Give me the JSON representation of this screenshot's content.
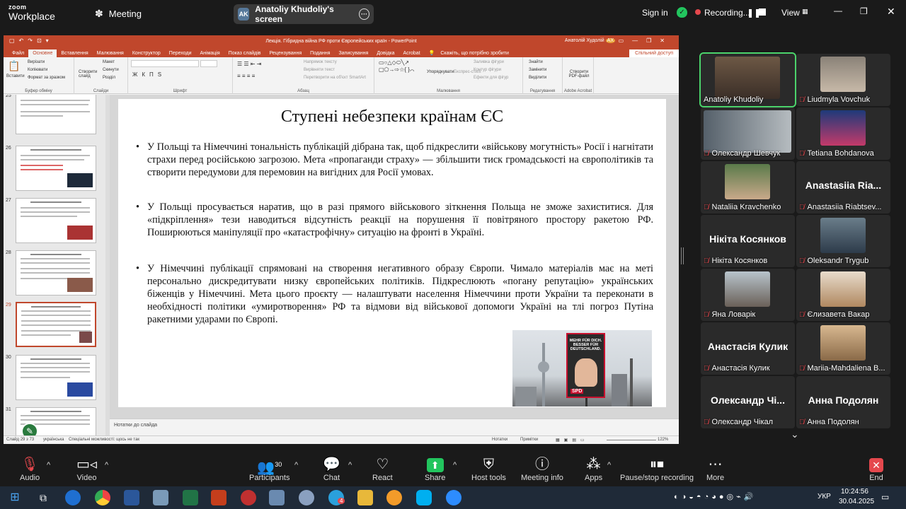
{
  "zoom": {
    "logo_line1": "zoom",
    "logo_line2": "Workplace",
    "meeting_label": "Meeting",
    "screen_share": {
      "initials": "AK",
      "label": "Anatoliy Khudoliy's screen"
    },
    "sign_in": "Sign in",
    "recording": "Recording...",
    "view": "View"
  },
  "ppt": {
    "window_title": "Лекція. Гібридна війна РФ проти Європейських країн - PowerPoint",
    "user": "Анатолій Худолій",
    "user_initials": "АХ",
    "tabs": [
      "Файл",
      "Основне",
      "Вставлення",
      "Малювання",
      "Конструктор",
      "Переходи",
      "Анімація",
      "Показ слайдів",
      "Рецензування",
      "Подання",
      "Записування",
      "Довідка",
      "Acrobat"
    ],
    "tell_me": "Скажіть, що потрібно зробити",
    "share": "Спільний доступ",
    "ribbon": {
      "clipboard": {
        "paste": "Вставити",
        "cut": "Вирізати",
        "copy": "Копіювати",
        "format": "Формат за зразком",
        "label": "Буфер обміну"
      },
      "slides": {
        "new": "Створити слайд",
        "layout": "Макет",
        "reset": "Скинути",
        "section": "Розділ",
        "label": "Слайди"
      },
      "font_label": "Шрифт",
      "paragraph": {
        "direction": "Напрямок тексту",
        "align": "Вирівняти текст",
        "smartart": "Перетворити на об'єкт SmartArt",
        "label": "Абзац"
      },
      "drawing": {
        "arrange": "Упорядкувати",
        "quick": "Експрес-стилі",
        "fill": "Заливка фігури",
        "outline": "Контур фігури",
        "effects": "Ефекти для фігур",
        "label": "Малювання"
      },
      "editing": {
        "find": "Знайти",
        "replace": "Замінити",
        "select": "Виділити",
        "label": "Редагування"
      },
      "acrobat": {
        "create": "Створити PDF-файл",
        "label": "Adobe Acrobat"
      }
    },
    "thumbnails": [
      {
        "num": "25",
        "title": "В Україні і наприклад країни та Європі та Ф.Р. з роки"
      },
      {
        "num": "26",
        "title": "РФ і Європа"
      },
      {
        "num": "27",
        "title": "Ступені небезпеки Європи та країнам РФ"
      },
      {
        "num": "28",
        "title": "Ступені небезпеки країнам РФ"
      },
      {
        "num": "29",
        "title": "Ступені небезпеки країнам ЄС"
      },
      {
        "num": "30",
        "title": "Ступені небезпеки країнам ЄС"
      },
      {
        "num": "31",
        "title": "Ступені небезпеки країнам ЄС - ретроспектива"
      }
    ],
    "slide": {
      "title": "Ступені небезпеки країнам ЄС",
      "bullets": [
        "У Польщі та Німеччині тональність публікацій дібрана так, щоб підкреслити «військову могутність» Росії і нагнітати страхи перед російською загрозою. Мета «пропаганди страху» — збільшити тиск громадськості на європолітиків та створити передумови для перемовин на вигідних для Росії умовах.",
        "У Польщі просувається наратив, що в разі прямого військового зіткнення Польща не зможе захиститися. Для «підкріплення» тези наводиться відсутність реакції на порушення її повітряного простору ракетою РФ. Поширюються маніпуляції про «катастрофічну» ситуацію на фронті в Україні.",
        "У Німеччині публікації спрямовані на створення негативного образу Європи. Чимало матеріалів має на меті персонально дискредитувати низку європейських політиків. Підкреслюють «погану репутацію» українських біженців у Німеччині. Мета цього проєкту — налаштувати населення Німеччини проти України та переконати в необхідності політики «умиротворення» РФ та відмови від військової допомоги Україні на тлі погроз Путіна ракетними ударами по Європі."
      ],
      "poster_text": "MEHR FÜR DICH. BESSER FÜR DEUTSCHLAND.",
      "poster_logo": "SPD"
    },
    "notes": "Нотатки до слайда",
    "status": {
      "slide_info": "Слайд 29 з 73",
      "language": "українська",
      "accessibility": "Спеціальні можливості: щось не так",
      "notes": "Нотатки",
      "comments": "Примітки",
      "zoom": "122%"
    }
  },
  "gallery": [
    {
      "name": "Anatoliy Khudoliy",
      "muted": false,
      "active": true,
      "photo": true
    },
    {
      "name": "Liudmyla Vovchuk",
      "muted": true,
      "photo": true
    },
    {
      "name": "Олександр Шевчук",
      "muted": true,
      "photo": true
    },
    {
      "name": "Tetiana Bohdanova",
      "muted": true,
      "photo": true
    },
    {
      "name": "Nataliia Kravchenko",
      "muted": true,
      "photo": true
    },
    {
      "name": "Anastasiia Riabtsev...",
      "big": "Anastasiia Ria...",
      "muted": true
    },
    {
      "name": "Нікіта Косянков",
      "big": "Нікіта Косянков",
      "muted": true
    },
    {
      "name": "Oleksandr Trygub",
      "muted": true,
      "photo": true
    },
    {
      "name": "Яна Ловарік",
      "muted": true,
      "photo": true
    },
    {
      "name": "Єлизавета Вакар",
      "muted": true,
      "photo": true
    },
    {
      "name": "Анастасія Кулик",
      "big": "Анастасія Кулик",
      "muted": true
    },
    {
      "name": "Mariia-Mahdaliena B...",
      "muted": true,
      "photo": true
    },
    {
      "name": "Олександр Чікал",
      "big": "Олександр Чі...",
      "muted": true
    },
    {
      "name": "Анна Подолян",
      "big": "Анна Подолян",
      "muted": true
    }
  ],
  "toolbar": {
    "audio": "Audio",
    "video": "Video",
    "participants": "Participants",
    "participants_count": "30",
    "chat": "Chat",
    "react": "React",
    "share": "Share",
    "host_tools": "Host tools",
    "meeting_info": "Meeting info",
    "apps": "Apps",
    "pause_recording": "Pause/stop recording",
    "more": "More",
    "end": "End"
  },
  "taskbar": {
    "language": "УКР",
    "time": "10:24:56",
    "date": "30.04.2025",
    "chrome_badge": "4"
  },
  "colors": {
    "ppt_accent": "#c0472c",
    "zoom_green": "#22c55e",
    "mute_red": "#e5484d",
    "active_speaker": "#4bd36b"
  }
}
